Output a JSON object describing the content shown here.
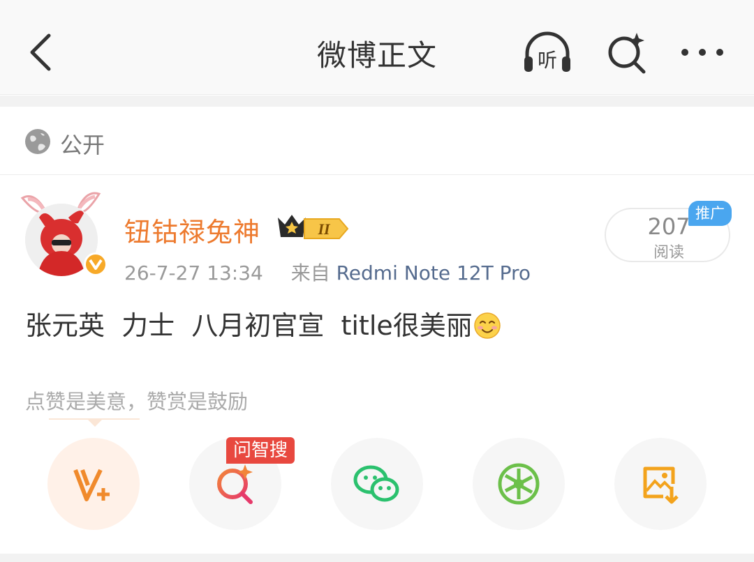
{
  "header": {
    "title": "微博正文",
    "listen_label": "听"
  },
  "privacy": {
    "label": "公开"
  },
  "post": {
    "username": "钮钴禄兔神",
    "level_badge": "II",
    "time": "26-7-27 13:34",
    "source_prefix": "来自",
    "source": "Redmi Note 12T Pro",
    "reads_count": "207",
    "reads_label": "阅读",
    "promo_tag": "推广",
    "text": "张元英  力士  八月初官宣  title很美丽",
    "emoji": "smiling-face-icon"
  },
  "reward": {
    "hint": "点赞是美意，赞赏是鼓励"
  },
  "actions": {
    "ai_tag": "问智搜",
    "items": [
      "reward-v-plus-icon",
      "ai-search-icon",
      "wechat-icon",
      "moments-icon",
      "save-image-icon"
    ]
  },
  "colors": {
    "username": "#ed7a2e",
    "source": "#556b8e",
    "promo": "#4aa6ef",
    "ai_tag": "#e8483f",
    "wechat": "#2bc16e",
    "moments": "#6cc04a",
    "save": "#f3a31c"
  }
}
